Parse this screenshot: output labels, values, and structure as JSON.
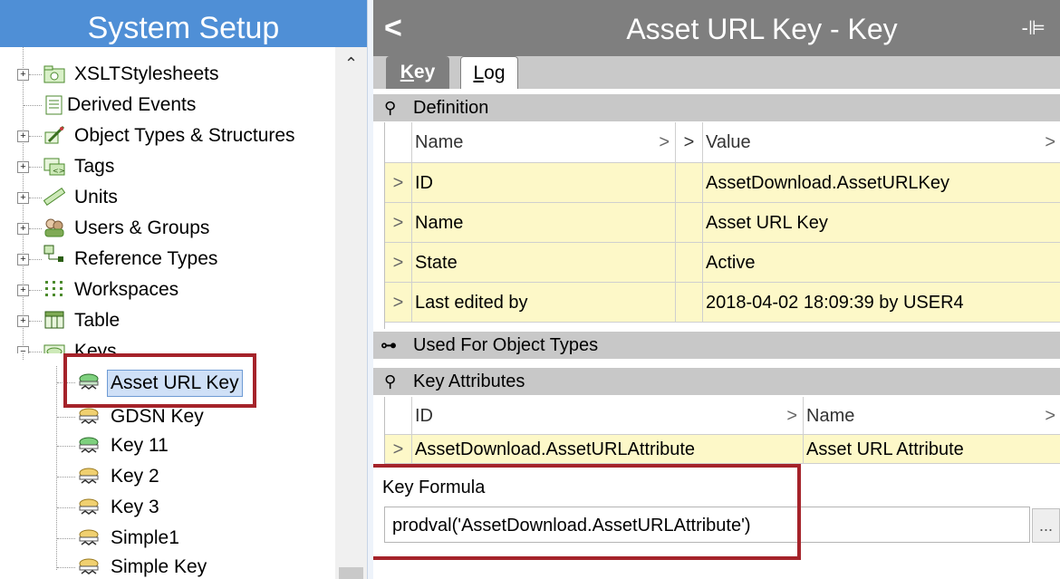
{
  "left_panel": {
    "title": "System Setup",
    "tree": [
      {
        "label": "XSLTStylesheets",
        "icon": "folder-camera-icon",
        "expandable": true
      },
      {
        "label": "Derived Events",
        "icon": "list-document-icon",
        "expandable": false
      },
      {
        "label": "Object Types & Structures",
        "icon": "object-types-icon",
        "expandable": true
      },
      {
        "label": "Tags",
        "icon": "tags-icon",
        "expandable": true
      },
      {
        "label": "Units",
        "icon": "ruler-icon",
        "expandable": true
      },
      {
        "label": "Users & Groups",
        "icon": "users-icon",
        "expandable": true
      },
      {
        "label": "Reference Types",
        "icon": "reference-types-icon",
        "expandable": true
      },
      {
        "label": "Workspaces",
        "icon": "workspaces-icon",
        "expandable": true
      },
      {
        "label": "Table",
        "icon": "table-icon",
        "expandable": true
      },
      {
        "label": "Keys",
        "icon": "keys-folder-icon",
        "expandable": true,
        "expanded": true
      },
      {
        "label": "Asset URL Key",
        "icon": "key-icon",
        "child": true,
        "selected": true
      },
      {
        "label": "GDSN Key",
        "icon": "key-icon",
        "child": true
      },
      {
        "label": "Key 11",
        "icon": "key-icon",
        "child": true
      },
      {
        "label": "Key 2",
        "icon": "key-icon",
        "child": true
      },
      {
        "label": "Key 3",
        "icon": "key-icon",
        "child": true
      },
      {
        "label": "Simple1",
        "icon": "key-icon",
        "child": true
      },
      {
        "label": "Simple Key",
        "icon": "key-icon",
        "child": true
      }
    ]
  },
  "header": {
    "back_glyph": "<",
    "title": "Asset URL Key - Key",
    "pin_glyph": "-⊫"
  },
  "tabs": {
    "key": {
      "first": "K",
      "rest": "ey"
    },
    "log": {
      "first": "L",
      "rest": "og"
    }
  },
  "definition": {
    "title": "Definition",
    "columns": {
      "name": "Name",
      "value": "Value"
    },
    "rows": [
      {
        "name": "ID",
        "value": "AssetDownload.AssetURLKey"
      },
      {
        "name": "Name",
        "value": "Asset URL Key"
      },
      {
        "name": "State",
        "value": "Active"
      },
      {
        "name": "Last edited by",
        "value": "2018-04-02 18:09:39 by USER4"
      }
    ]
  },
  "used_for": {
    "title": "Used For Object Types"
  },
  "key_attributes": {
    "title": "Key Attributes",
    "columns": {
      "id": "ID",
      "name": "Name"
    },
    "rows": [
      {
        "id": "AssetDownload.AssetURLAttribute",
        "name": "Asset URL Attribute"
      }
    ]
  },
  "formula": {
    "label": "Key Formula",
    "value": "prodval('AssetDownload.AssetURLAttribute')",
    "button": "..."
  },
  "colors": {
    "title_bar": "#4f8fd6",
    "header_bar": "#7f7f7f",
    "data_row": "#fdf8c8",
    "highlight_box": "#a5232a"
  }
}
